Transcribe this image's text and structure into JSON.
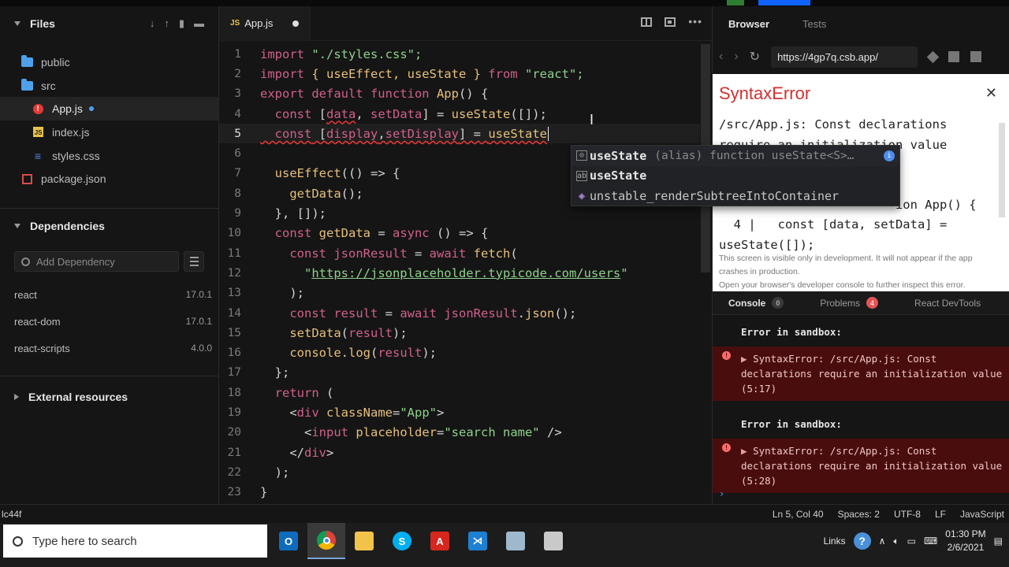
{
  "sidebar": {
    "files_title": "Files",
    "tree": [
      {
        "label": "public",
        "type": "folder"
      },
      {
        "label": "src",
        "type": "folder"
      },
      {
        "label": "App.js",
        "type": "error"
      },
      {
        "label": "index.js",
        "type": "js"
      },
      {
        "label": "styles.css",
        "type": "css"
      },
      {
        "label": "package.json",
        "type": "json"
      }
    ],
    "dependencies_title": "Dependencies",
    "add_dependency_placeholder": "Add Dependency",
    "dependencies": [
      {
        "name": "react",
        "version": "17.0.1"
      },
      {
        "name": "react-dom",
        "version": "17.0.1"
      },
      {
        "name": "react-scripts",
        "version": "4.0.0"
      }
    ],
    "external_title": "External resources"
  },
  "editor": {
    "tab_label": "App.js",
    "tab_badge": "JS",
    "line_numbers": [
      "1",
      "2",
      "3",
      "4",
      "5",
      "6",
      "7",
      "8",
      "9",
      "10",
      "11",
      "12",
      "13",
      "14",
      "15",
      "16",
      "17",
      "18",
      "19",
      "20",
      "21",
      "22",
      "23"
    ],
    "code": {
      "l1a": "import",
      "l1b": " \"./styles.css\";",
      "l2a": "import",
      "l2b": " { useEffect, useState } ",
      "l2c": "from",
      "l2d": " \"react\";",
      "l3a": "export default function",
      "l3b": " App",
      "l3c": "() {",
      "l4a": "  const",
      "l4b": " [",
      "l4c": "data",
      "l4d": ", ",
      "l4e": "setData",
      "l4f": "] = ",
      "l4g": "useState",
      "l4h": "([]);",
      "l5a": "  const",
      "l5b": " [",
      "l5c": "display",
      "l5d": ",",
      "l5e": "setDisplay",
      "l5f": "] = ",
      "l5g": "useState",
      "l7a": "  useEffect",
      "l7b": "(() => {",
      "l8a": "    getData",
      "l8b": "();",
      "l9": "  }, []);",
      "l10a": "  const",
      "l10b": " getData",
      "l10c": " = ",
      "l10d": "async",
      "l10e": " () => {",
      "l11a": "    const",
      "l11b": " jsonResult",
      "l11c": " = ",
      "l11d": "await",
      "l11e": " fetch",
      "l11f": "(",
      "l12a": "      \"",
      "l12b": "https://jsonplaceholder.typicode.com/users",
      "l12c": "\"",
      "l13": "    );",
      "l14a": "    const",
      "l14b": " result",
      "l14c": " = ",
      "l14d": "await",
      "l14e": " jsonResult",
      "l14f": ".",
      "l14g": "json",
      "l14h": "();",
      "l15a": "    setData",
      "l15b": "(",
      "l15c": "result",
      "l15d": ");",
      "l16a": "    console",
      "l16b": ".",
      "l16c": "log",
      "l16d": "(",
      "l16e": "result",
      "l16f": ");",
      "l17": "  };",
      "l18a": "  return",
      "l18b": " (",
      "l19a": "    <",
      "l19b": "div",
      "l19c": " className",
      "l19d": "=",
      "l19e": "\"App\"",
      "l19f": ">",
      "l20a": "      <",
      "l20b": "input",
      "l20c": " placeholder",
      "l20d": "=",
      "l20e": "\"search name\"",
      "l20f": " />",
      "l21a": "    </",
      "l21b": "div",
      "l21c": ">",
      "l22": "  );",
      "l23": "}"
    },
    "autocomplete": [
      {
        "label": "useState",
        "detail": "(alias) function useState<S>…"
      },
      {
        "label": "useState",
        "detail": ""
      },
      {
        "label": "unstable_renderSubtreeIntoContainer",
        "detail": ""
      }
    ]
  },
  "preview": {
    "tabs": [
      "Browser",
      "Tests"
    ],
    "url": "https://4gp7q.csb.app/",
    "error_title": "SyntaxError",
    "error_lines": [
      "/src/App.js: Const declarations",
      "require an initialization value (5:28)",
      "",
      "                        ion App() {",
      "  4 |   const [data, setData] =",
      "useState([]);"
    ],
    "error_footer": [
      "This screen is visible only in development. It will not appear if the app crashes in production.",
      "Open your browser's developer console to further inspect this error."
    ],
    "console_tabs": [
      {
        "label": "Console",
        "count": "0"
      },
      {
        "label": "Problems",
        "count": "4"
      },
      {
        "label": "React DevTools",
        "count": ""
      }
    ],
    "console_entries": [
      {
        "title": "Error in sandbox:",
        "message": "SyntaxError: /src/App.js: Const declarations require an initialization value (5:17)"
      },
      {
        "title": "Error in sandbox:",
        "message": "SyntaxError: /src/App.js: Const declarations require an initialization value (5:28)"
      }
    ]
  },
  "status": {
    "left": "lc44f",
    "position": "Ln 5, Col 40",
    "spaces": "Spaces: 2",
    "encoding": "UTF-8",
    "eol": "LF",
    "language": "JavaScript"
  },
  "taskbar": {
    "search_placeholder": "Type here to search",
    "links": "Links",
    "time": "01:30 PM",
    "date": "2/6/2021"
  }
}
